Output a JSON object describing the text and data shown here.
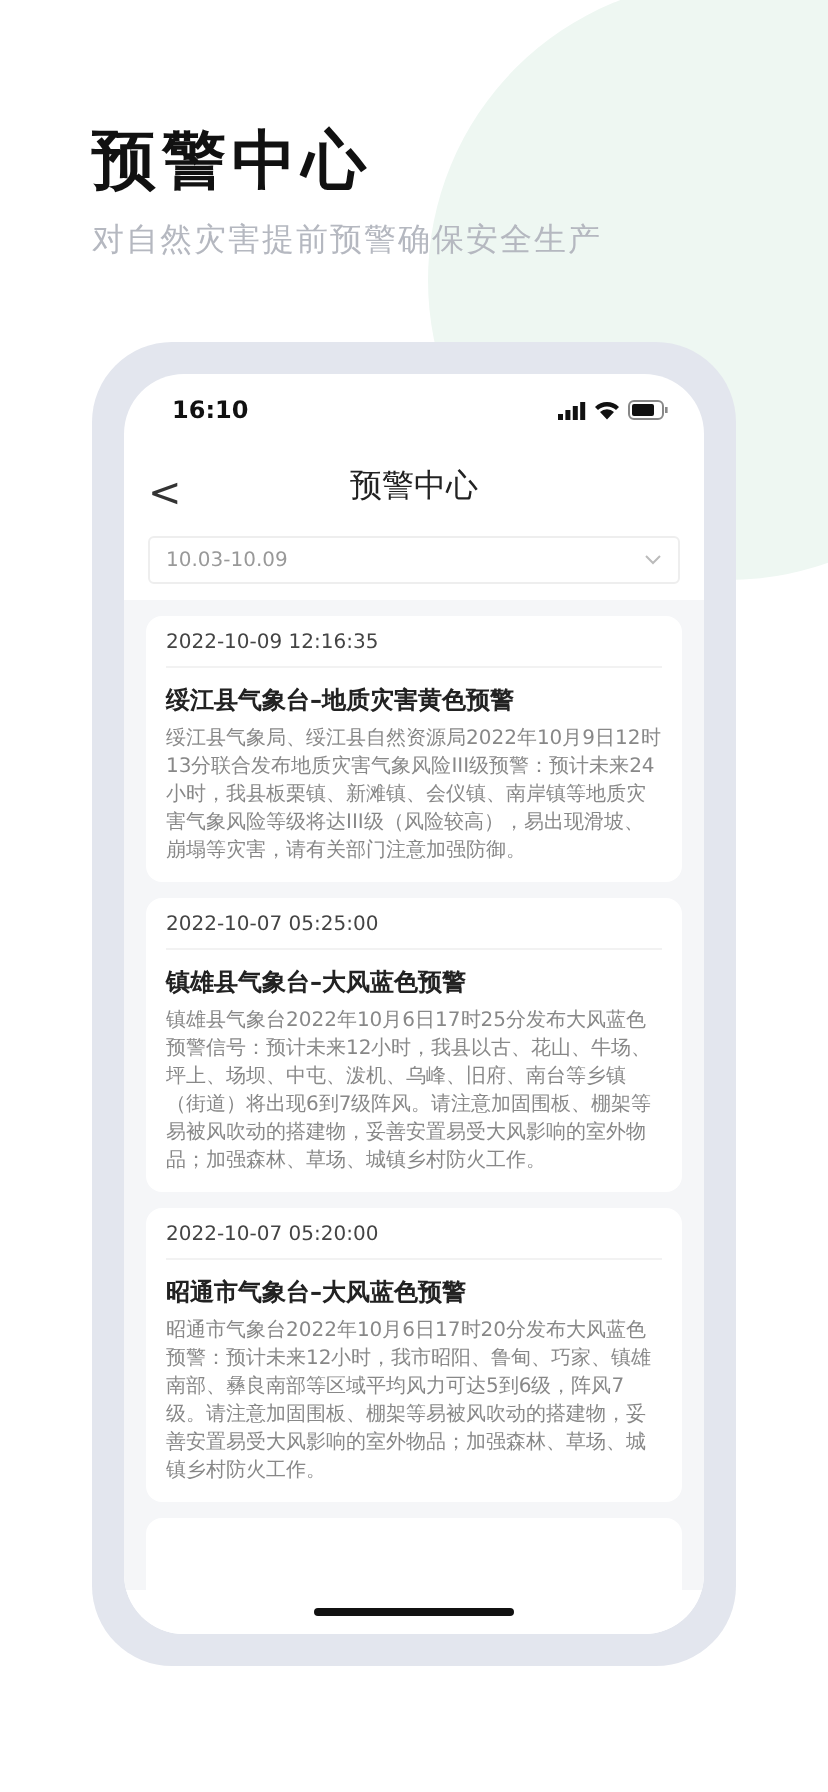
{
  "headline": "预警中心",
  "subtitle": "对自然灾害提前预警确保安全生产",
  "status_bar": {
    "time": "16:10"
  },
  "nav": {
    "back": "<",
    "title": "预警中心"
  },
  "date_filter": {
    "value": "10.03-10.09"
  },
  "alerts": [
    {
      "time": "2022-10-09 12:16:35",
      "title": "绥江县气象台–地质灾害黄色预警",
      "body": "绥江县气象局、绥江县自然资源局2022年10月9日12时13分联合发布地质灾害气象风险III级预警：预计未来24小时，我县板栗镇、新滩镇、会仪镇、南岸镇等地质灾害气象风险等级将达III级（风险较高），易出现滑坡、崩塌等灾害，请有关部门注意加强防御。"
    },
    {
      "time": "2022-10-07 05:25:00",
      "title": "镇雄县气象台–大风蓝色预警",
      "body": "镇雄县气象台2022年10月6日17时25分发布大风蓝色预警信号：预计未来12小时，我县以古、花山、牛场、坪上、场坝、中屯、泼机、乌峰、旧府、南台等乡镇（街道）将出现6到7级阵风。请注意加固围板、棚架等易被风吹动的搭建物，妥善安置易受大风影响的室外物品；加强森林、草场、城镇乡村防火工作。"
    },
    {
      "time": "2022-10-07 05:20:00",
      "title": "昭通市气象台–大风蓝色预警",
      "body": "昭通市气象台2022年10月6日17时20分发布大风蓝色预警：预计未来12小时，我市昭阳、鲁甸、巧家、镇雄南部、彝良南部等区域平均风力可达5到6级，阵风7级。请注意加固围板、棚架等易被风吹动的搭建物，妥善安置易受大风影响的室外物品；加强森林、草场、城镇乡村防火工作。"
    }
  ]
}
